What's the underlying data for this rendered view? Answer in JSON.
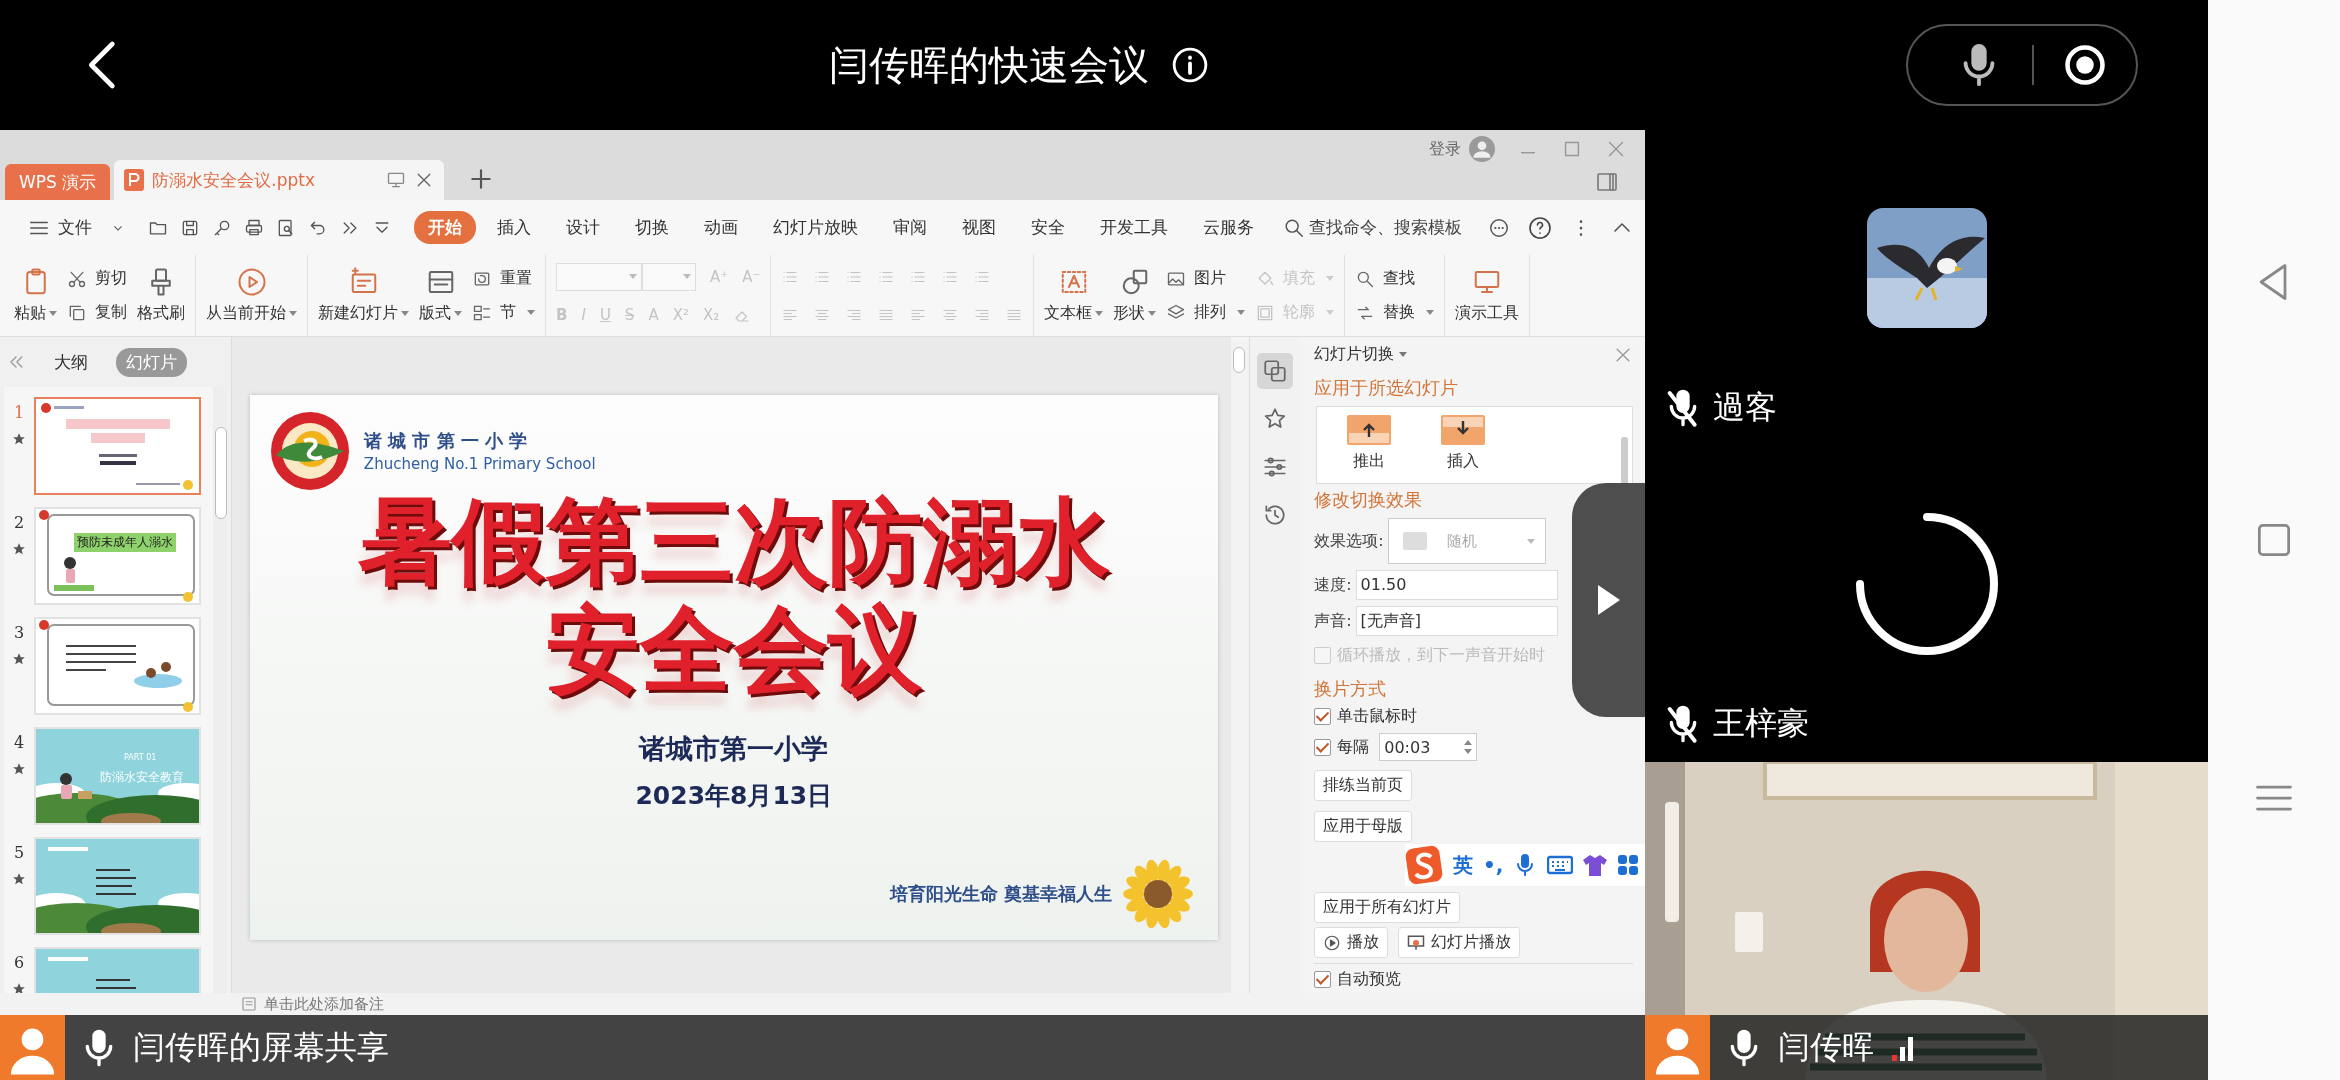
{
  "meeting": {
    "title": "闫传晖的快速会议"
  },
  "wps": {
    "app_tab": "WPS 演示",
    "doc_tab": "防溺水安全会议.pptx",
    "login": "登录",
    "file_menu": "文件",
    "menu_tabs": [
      {
        "label": "开始",
        "selected": true
      },
      {
        "label": "插入",
        "selected": false
      },
      {
        "label": "设计",
        "selected": false
      },
      {
        "label": "切换",
        "selected": false
      },
      {
        "label": "动画",
        "selected": false
      },
      {
        "label": "幻灯片放映",
        "selected": false
      },
      {
        "label": "审阅",
        "selected": false
      },
      {
        "label": "视图",
        "selected": false
      },
      {
        "label": "安全",
        "selected": false
      },
      {
        "label": "开发工具",
        "selected": false
      },
      {
        "label": "云服务",
        "selected": false
      }
    ],
    "search": {
      "placeholder": "查找命令、搜索模板"
    },
    "ribbon": [
      {
        "kind": "buttons",
        "items": [
          {
            "label": "粘贴",
            "kind": "large",
            "dropdown": true,
            "disabled": false
          },
          {
            "label": "剪切",
            "kind": "small",
            "dropdown": false,
            "disabled": false
          },
          {
            "label": "复制",
            "kind": "small",
            "dropdown": false,
            "disabled": false
          },
          {
            "label": "格式刷",
            "kind": "large",
            "dropdown": false,
            "disabled": false
          }
        ]
      },
      {
        "kind": "buttons",
        "items": [
          {
            "label": "从当前开始",
            "kind": "large",
            "dropdown": true,
            "disabled": false
          }
        ]
      },
      {
        "kind": "buttons",
        "items": [
          {
            "label": "新建幻灯片",
            "kind": "large",
            "dropdown": true,
            "disabled": false
          },
          {
            "label": "版式",
            "kind": "large",
            "dropdown": true,
            "disabled": false
          },
          {
            "label": "重置",
            "kind": "small",
            "dropdown": false,
            "disabled": false
          },
          {
            "label": "节",
            "kind": "small",
            "dropdown": true,
            "disabled": false
          }
        ]
      },
      {
        "kind": "font",
        "grow": [
          "A⁺",
          "A⁻"
        ],
        "styles": [
          "B",
          "I",
          "U",
          "S",
          "A",
          "X²",
          "X₂"
        ]
      },
      {
        "kind": "paragraph"
      },
      {
        "kind": "buttons",
        "items": [
          {
            "label": "文本框",
            "kind": "large",
            "dropdown": true,
            "disabled": false
          },
          {
            "label": "形状",
            "kind": "large",
            "dropdown": true,
            "disabled": false
          },
          {
            "label": "图片",
            "kind": "small",
            "dropdown": false,
            "disabled": false
          },
          {
            "label": "排列",
            "kind": "small",
            "dropdown": true,
            "disabled": false
          },
          {
            "label": "填充",
            "kind": "small",
            "dropdown": true,
            "disabled": true
          },
          {
            "label": "轮廓",
            "kind": "small",
            "dropdown": true,
            "disabled": true
          }
        ]
      },
      {
        "kind": "buttons",
        "items": [
          {
            "label": "查找",
            "kind": "small",
            "dropdown": false,
            "disabled": false
          },
          {
            "label": "替换",
            "kind": "small",
            "dropdown": true,
            "disabled": false
          }
        ]
      },
      {
        "kind": "buttons",
        "items": [
          {
            "label": "演示工具",
            "kind": "large",
            "dropdown": false,
            "disabled": false
          }
        ]
      }
    ],
    "panel_tabs": [
      {
        "label": "大纲",
        "selected": false
      },
      {
        "label": "幻灯片",
        "selected": true
      }
    ],
    "thumbnails": [
      {
        "number": "1",
        "kind": "title",
        "selected": true
      },
      {
        "number": "2",
        "kind": "heading",
        "selected": false,
        "text": "预防未成年人溺水"
      },
      {
        "number": "3",
        "kind": "text",
        "selected": false
      },
      {
        "number": "4",
        "kind": "section",
        "selected": false,
        "tag": "PART 01",
        "text": "防溺水安全教育"
      },
      {
        "number": "5",
        "kind": "scene",
        "selected": false
      },
      {
        "number": "6",
        "kind": "scene",
        "selected": false
      }
    ],
    "slide": {
      "school_cn": "诸 城 市 第 一 小 学",
      "school_en": "Zhucheng No.1 Primary School",
      "title_lines": [
        "暑假第三次防溺水",
        "安全会议"
      ],
      "subtitle": "诸城市第一小学",
      "date": "2023年8月13日",
      "motto": "培育阳光生命 奠基幸福人生"
    },
    "side_tools": [
      {
        "selected": true
      },
      {
        "selected": false
      },
      {
        "selected": false
      },
      {
        "selected": false
      }
    ],
    "task_pane": {
      "title": "幻灯片切换",
      "section_apply": "应用于所选幻灯片",
      "effects": [
        {
          "label": "推出",
          "kind": "up"
        },
        {
          "label": "插入",
          "kind": "down"
        }
      ],
      "section_modify": "修改切换效果",
      "option_label": "效果选项:",
      "option_value": "随机",
      "speed_label": "速度:",
      "speed": "01.50",
      "sound_label": "声音:",
      "sound": "[无声音]",
      "loop": {
        "label": "循环播放，到下一声音开始时",
        "checked": false,
        "disabled": true
      },
      "section_advance": "换片方式",
      "on_click": {
        "label": "单击鼠标时",
        "checked": true
      },
      "every": {
        "label": "每隔",
        "checked": true,
        "value": "00:03"
      },
      "buttons": [
        "排练当前页",
        "应用于母版",
        "应用于所有幻灯片"
      ],
      "play_buttons": [
        "播放",
        "幻灯片播放"
      ],
      "auto_preview": {
        "label": "自动预览",
        "checked": true
      }
    },
    "notes": {
      "placeholder": "单击此处添加备注"
    }
  },
  "ime": {
    "lang": "英",
    "punct": "•,"
  },
  "participants": [
    {
      "name": "過客",
      "kind": "avatar",
      "muted": true
    },
    {
      "name": "王梓豪",
      "kind": "loading",
      "muted": true
    }
  ],
  "share": {
    "label": "闫传晖的屏幕共享",
    "muted": false
  },
  "self_view": {
    "name": "闫传晖",
    "muted": false
  }
}
